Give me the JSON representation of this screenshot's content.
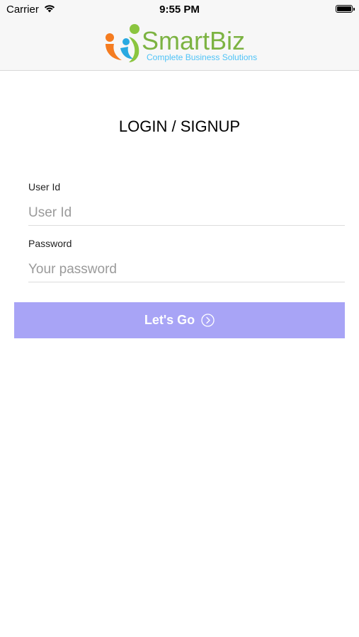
{
  "status_bar": {
    "carrier": "Carrier",
    "time": "9:55 PM",
    "icons": [
      "wifi-icon",
      "battery-icon"
    ]
  },
  "header": {
    "logo": {
      "brand": "SmartBiz",
      "tagline": "Complete Business Solutions",
      "colors": {
        "brand_text": "#7cb342",
        "tagline_text": "#4fc3f7",
        "figure_orange": "#f57c20",
        "figure_blue": "#29a9e1",
        "figure_green": "#8bc53f"
      }
    }
  },
  "title": "LOGIN / SIGNUP",
  "form": {
    "user_id": {
      "label": "User Id",
      "placeholder": "User Id",
      "value": ""
    },
    "password": {
      "label": "Password",
      "placeholder": "Your password",
      "value": ""
    },
    "submit": {
      "label": "Let's Go",
      "icon": "chevron-circle-right-icon",
      "color": "#a8a4f6"
    }
  }
}
